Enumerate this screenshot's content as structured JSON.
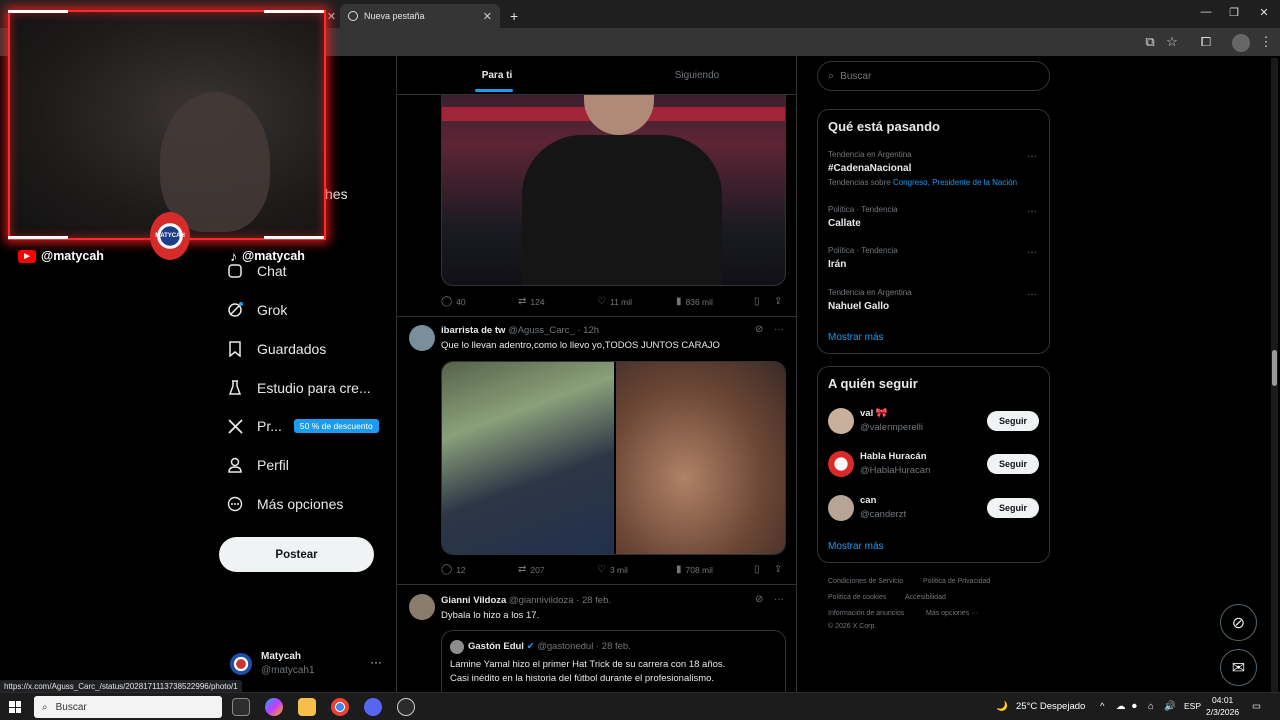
{
  "browser": {
    "tab_new": "Nueva pestaña",
    "status_url": "https://x.com/Aguss_Carc_/status/2028171113738522996/photo/1"
  },
  "overlay": {
    "youtube_handle": "@matycah",
    "tiktok_handle": "@matycah",
    "logo_text": "MATYCAH"
  },
  "nav": {
    "partial_label": "ches",
    "chat": "Chat",
    "grok": "Grok",
    "bookmarks": "Guardados",
    "studio": "Estudio para cre...",
    "premium": "Pr...",
    "premium_badge": "50 % de descuento",
    "profile": "Perfil",
    "more": "Más opciones",
    "post": "Postear",
    "account_name": "Matycah",
    "account_handle": "@matycah1"
  },
  "feed": {
    "tab_for_you": "Para ti",
    "tab_following": "Siguiendo",
    "tweet1_metrics": {
      "replies": "40",
      "retweets": "124",
      "likes": "11 mil",
      "views": "836 mil"
    },
    "tweet2": {
      "name": "ibarrista de tw",
      "handle": "@Aguss_Carc_",
      "time": "· 12h",
      "text": "Que lo llevan adentro,como lo llevo yo,TODOS JUNTOS CARAJO",
      "replies": "12",
      "retweets": "207",
      "likes": "3 mil",
      "views": "708 mil"
    },
    "tweet3": {
      "name": "Gianni Vildoza",
      "handle": "@giannivildoza",
      "time": "· 28 feb.",
      "text": "Dybala lo hizo a los 17.",
      "quote_name": "Gastón Edul",
      "quote_handle": "@gastonedul",
      "quote_time": "· 28 feb.",
      "quote_line1": "Lamine Yamal hizo el primer Hat Trick de su carrera con 18 años.",
      "quote_line2": "Casi inédito en la historia del fútbol durante el profesionalismo."
    }
  },
  "sidebar": {
    "search_placeholder": "Buscar",
    "trends_title": "Qué está pasando",
    "trends": [
      {
        "meta": "Tendencia en Argentina",
        "name": "#CadenaNacional",
        "sub_prefix": "Tendencias sobre ",
        "sub_links": "Congreso, Presidente de la Nación"
      },
      {
        "meta": "Política · Tendencia",
        "name": "Callate"
      },
      {
        "meta": "Política · Tendencia",
        "name": "Irán"
      },
      {
        "meta": "Tendencia en Argentina",
        "name": "Nahuel Gallo"
      }
    ],
    "show_more": "Mostrar más",
    "follow_title": "A quién seguir",
    "follow": [
      {
        "name": "val 🎀",
        "handle": "@valennperelli",
        "button": "Seguir"
      },
      {
        "name": "Habla Huracán",
        "handle": "@HablaHuracan",
        "button": "Seguir"
      },
      {
        "name": "can",
        "handle": "@canderzt",
        "button": "Seguir"
      }
    ],
    "show_more_2": "Mostrar más",
    "footer": {
      "terms": "Condiciones de Servicio",
      "privacy": "Política de Privacidad",
      "cookies": "Política de cookies",
      "accessibility": "Accesibilidad",
      "ads": "Información de anuncios",
      "more": "Más opciones ···",
      "copyright": "© 2026 X Corp."
    }
  },
  "taskbar": {
    "search": "Buscar",
    "weather": "25°C  Despejado",
    "lang": "ESP",
    "time": "04:01",
    "date": "2/3/2026"
  },
  "colors": {
    "accent": "#1d9bf0",
    "webcam_border": "#ff2a2a"
  }
}
